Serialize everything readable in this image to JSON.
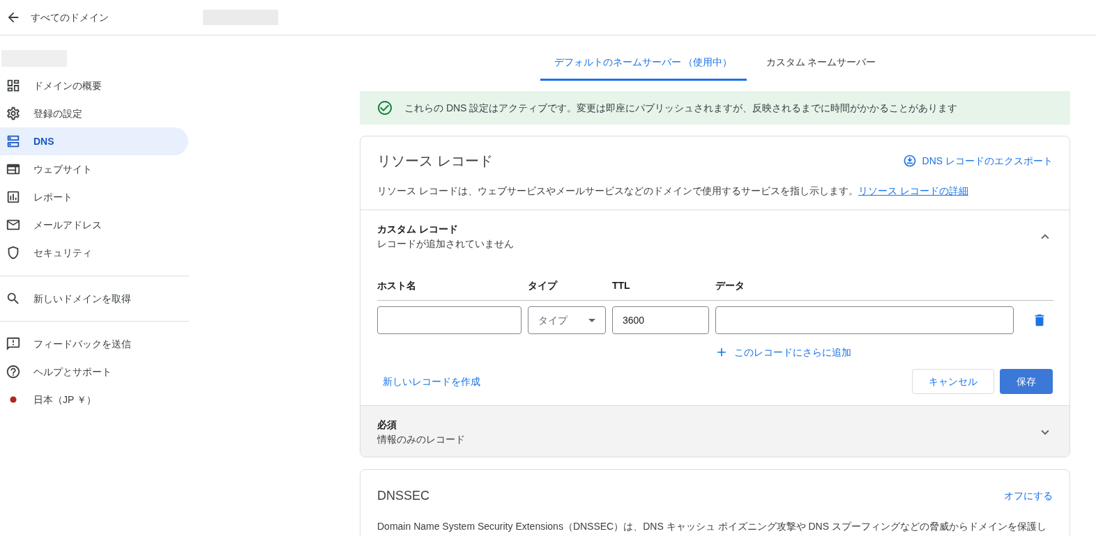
{
  "header": {
    "back_label": "すべてのドメイン"
  },
  "sidebar": {
    "groups": [
      {
        "items": [
          {
            "label": "ドメインの概要",
            "selected": false
          },
          {
            "label": "登録の設定",
            "selected": false
          },
          {
            "label": "DNS",
            "selected": true
          },
          {
            "label": "ウェブサイト",
            "selected": false
          },
          {
            "label": "レポート",
            "selected": false
          },
          {
            "label": "メールアドレス",
            "selected": false
          },
          {
            "label": "セキュリティ",
            "selected": false
          }
        ]
      },
      {
        "items": [
          {
            "label": "新しいドメインを取得",
            "selected": false
          }
        ]
      },
      {
        "items": [
          {
            "label": "フィードバックを送信",
            "selected": false
          },
          {
            "label": "ヘルプとサポート",
            "selected": false
          },
          {
            "label": "日本（JP ￥）",
            "selected": false
          }
        ]
      }
    ]
  },
  "tabs": [
    {
      "label": "デフォルトのネームサーバー （使用中）",
      "selected": true
    },
    {
      "label": "カスタム ネームサーバー",
      "selected": false
    }
  ],
  "banner": {
    "text": "これらの DNS 設定はアクティブです。変更は即座にパブリッシュされますが、反映されるまでに時間がかかることがあります"
  },
  "resource_records": {
    "title": "リソース レコード",
    "export_link": "DNS レコードのエクスポート",
    "description": "リソース レコードは、ウェブサービスやメールサービスなどのドメインで使用するサービスを指し示します。",
    "details_link": "リソース レコードの詳細",
    "sections": [
      {
        "title": "カスタム レコード",
        "subtitle": "レコードが追加されていません",
        "expanded": true,
        "columns": [
          "ホスト名",
          "タイプ",
          "TTL",
          "データ"
        ],
        "row": {
          "type_placeholder": "タイプ",
          "ttl": "3600"
        },
        "add_more": "このレコードにさらに追加",
        "create_link": "新しいレコードを作成",
        "cancel": "キャンセル",
        "save": "保存"
      },
      {
        "title": "必須",
        "subtitle": "情報のみのレコード",
        "expanded": false
      }
    ]
  },
  "dnssec": {
    "title": "DNSSEC",
    "action": "オフにする",
    "description": "Domain Name System Security Extensions（DNSSEC）は、DNS キャッシュ ポイズニング攻撃や DNS スプーフィングなどの脅威からドメインを保護し"
  }
}
